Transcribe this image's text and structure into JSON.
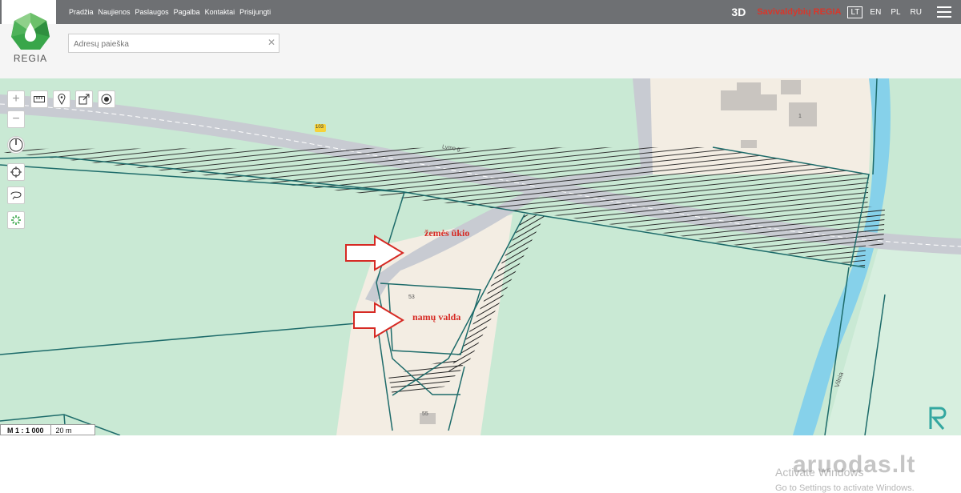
{
  "nav": {
    "items": [
      "Pradžia",
      "Naujienos",
      "Paslaugos",
      "Pagalba",
      "Kontaktai",
      "Prisijungti"
    ]
  },
  "right_nav": {
    "view_3d": "3D",
    "brand": "Savivaldybių REGIA",
    "languages": [
      "LT",
      "EN",
      "PL",
      "RU"
    ],
    "active_language": "LT"
  },
  "logo": {
    "text": "REGIA"
  },
  "search": {
    "placeholder": "Adresų paieška",
    "value": ""
  },
  "map": {
    "scale_text": "M 1 : 1 000",
    "scale_distance": "20 m",
    "road_badge": "103",
    "street_label": "Lymo g.",
    "river_label": "Vilnia",
    "parcel_53": "53",
    "parcel_55": "55",
    "building_1": "1",
    "label_land": "žemės ūkio",
    "label_home": "namų valda",
    "colors": {
      "land": "#c9e9d4",
      "parcel": "#f3ede3",
      "river": "#86d1ea",
      "road": "#c8cbd2",
      "boundary": "#1d6b6a",
      "label": "#d62a24"
    }
  },
  "overlay": {
    "watermark_title": "Activate Windows",
    "watermark_sub": "Go to Settings to activate Windows.",
    "brand_mark": "aruodas.lt"
  }
}
